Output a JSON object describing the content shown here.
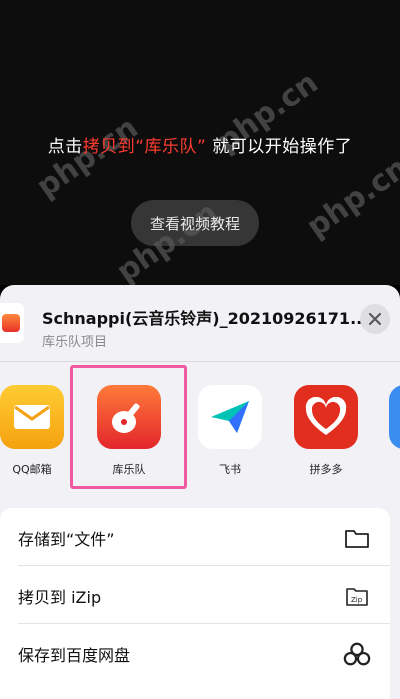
{
  "video": {
    "instruction_prefix": "点击",
    "instruction_highlight": "拷贝到“库乐队”",
    "instruction_suffix": "就可以开始操作了",
    "watch_button": "查看视频教程",
    "watermark": "php.cn"
  },
  "share_sheet": {
    "file_title": "Schnappi(云音乐铃声)_20210926171...",
    "file_subtitle": "库乐队项目",
    "apps": [
      {
        "label": "QQ邮箱",
        "icon": "mail-icon"
      },
      {
        "label": "库乐队",
        "icon": "guitar-icon"
      },
      {
        "label": "飞书",
        "icon": "paper-plane-icon"
      },
      {
        "label": "拼多多",
        "icon": "pinduoduo-icon"
      }
    ],
    "actions": [
      {
        "label": "存储到“文件”",
        "icon": "folder-icon"
      },
      {
        "label": "拷贝到 iZip",
        "icon": "zip-icon"
      },
      {
        "label": "保存到百度网盘",
        "icon": "cloud-icon"
      }
    ]
  },
  "colors": {
    "highlight_text": "#ff3b2f",
    "selection_border": "#f05aa0"
  }
}
